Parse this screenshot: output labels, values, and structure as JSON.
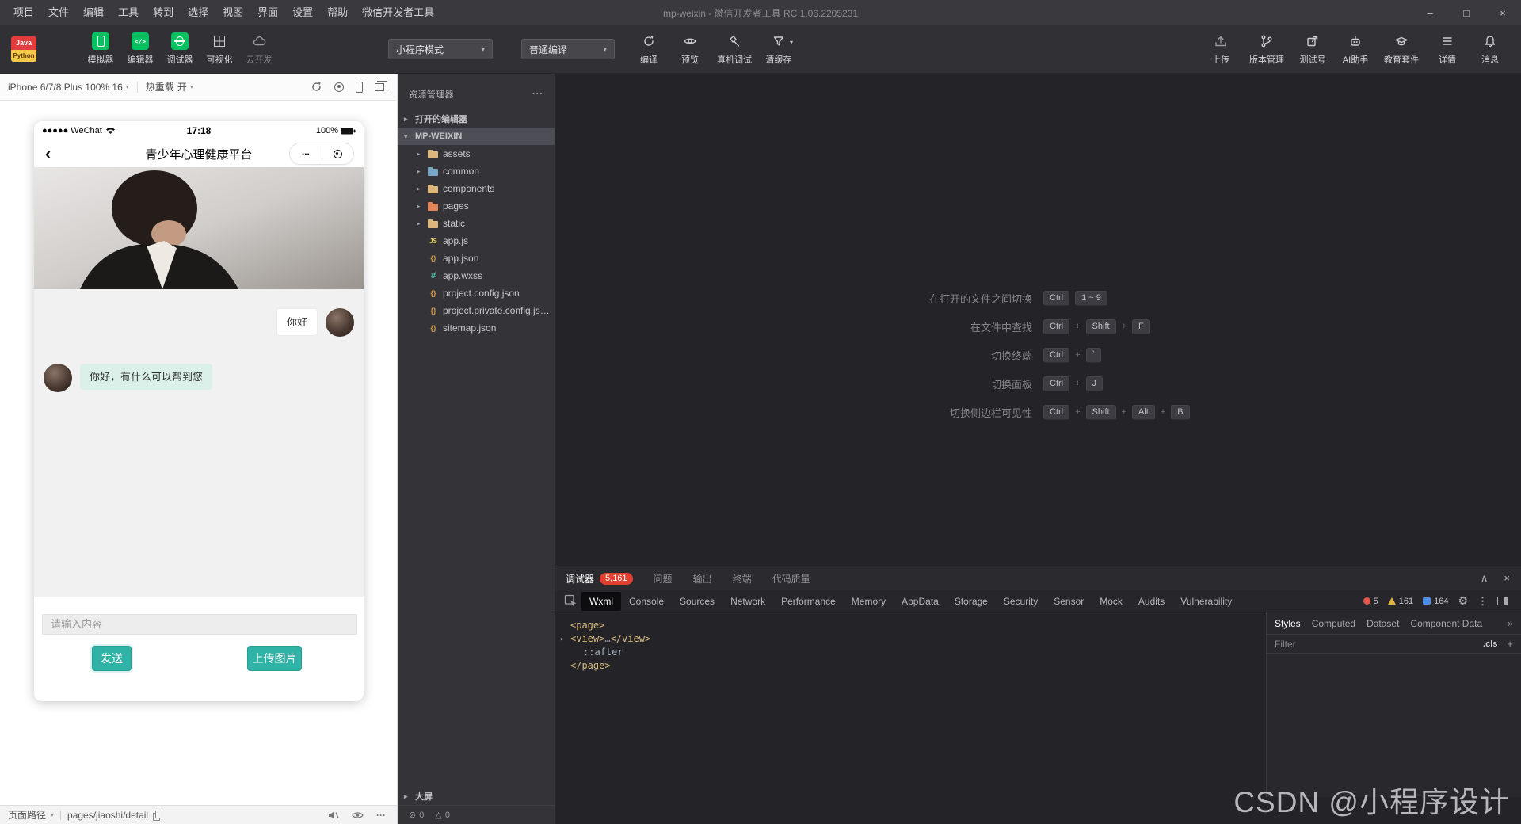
{
  "icons": {
    "minimize": "–",
    "maximize": "□",
    "close": "×",
    "collapse": "∧",
    "caret_down": "▾",
    "caret_right": "▸",
    "back": "‹",
    "more_h": "···",
    "more_v": "⋮",
    "overflow": "»",
    "add": "+",
    "gear": "⚙",
    "capsule_dots": "···",
    "error": "⊘",
    "warning": "△"
  },
  "menubar": {
    "items": [
      "项目",
      "文件",
      "编辑",
      "工具",
      "转到",
      "选择",
      "视图",
      "界面",
      "设置",
      "帮助",
      "微信开发者工具"
    ],
    "title": "mp-weixin - 微信开发者工具 RC 1.06.2205231"
  },
  "toolbar": {
    "logo_top": "Java",
    "logo_bottom": "Python",
    "simulator_label": "模拟器",
    "editor_label": "编辑器",
    "debugger_label": "调试器",
    "visual_label": "可视化",
    "cloud_label": "云开发",
    "mode_select": "小程序模式",
    "compile_select": "普通编译",
    "compile_label": "编译",
    "preview_label": "预览",
    "device_debug_label": "真机调试",
    "clear_cache_label": "清缓存",
    "upload_label": "上传",
    "version_label": "版本管理",
    "test_account_label": "测试号",
    "ai_label": "AI助手",
    "edu_label": "教育套件",
    "details_label": "详情",
    "messages_label": "消息"
  },
  "simulator": {
    "device_label": "iPhone 6/7/8 Plus 100% 16",
    "hot_reload_label": "热重载",
    "hot_reload_value": "开",
    "phone": {
      "carrier": "●●●●● WeChat",
      "time": "17:18",
      "battery": "100%",
      "nav_title": "青少年心理健康平台",
      "messages": [
        {
          "side": "right",
          "text": "你好"
        },
        {
          "side": "left",
          "text": "你好，有什么可以帮到您"
        }
      ],
      "input_placeholder": "请输入内容",
      "send_button": "发送",
      "upload_button": "上传图片"
    },
    "statusbar": {
      "page_path_label": "页面路径",
      "page_path": "pages/jiaoshi/detail"
    }
  },
  "explorer": {
    "title": "资源管理器",
    "open_editors": "打开的编辑器",
    "project": "MP-WEIXIN",
    "tree": [
      {
        "name": "assets",
        "kind": "folder",
        "color": "#dcb67a"
      },
      {
        "name": "common",
        "kind": "folder",
        "color": "#7ba7c7"
      },
      {
        "name": "components",
        "kind": "folder",
        "color": "#dcb67a"
      },
      {
        "name": "pages",
        "kind": "folder",
        "color": "#e0845a"
      },
      {
        "name": "static",
        "kind": "folder",
        "color": "#dcb67a"
      },
      {
        "name": "app.js",
        "kind": "js"
      },
      {
        "name": "app.json",
        "kind": "json"
      },
      {
        "name": "app.wxss",
        "kind": "wxss"
      },
      {
        "name": "project.config.json",
        "kind": "json"
      },
      {
        "name": "project.private.config.js…",
        "kind": "json"
      },
      {
        "name": "sitemap.json",
        "kind": "json"
      }
    ],
    "bottom_section": "大屏",
    "error_count": "0",
    "warning_count": "0"
  },
  "editor": {
    "shortcuts": [
      {
        "label": "在打开的文件之间切换",
        "keys": [
          "Ctrl",
          "1 ~ 9"
        ],
        "plus": false
      },
      {
        "label": "在文件中查找",
        "keys": [
          "Ctrl",
          "Shift",
          "F"
        ],
        "plus": true
      },
      {
        "label": "切换终端",
        "keys": [
          "Ctrl",
          "`"
        ],
        "plus": true
      },
      {
        "label": "切换面板",
        "keys": [
          "Ctrl",
          "J"
        ],
        "plus": true
      },
      {
        "label": "切换侧边栏可见性",
        "keys": [
          "Ctrl",
          "Shift",
          "Alt",
          "B"
        ],
        "plus": true
      }
    ]
  },
  "debugger": {
    "tabs": [
      {
        "label": "调试器",
        "badge": "5,161",
        "state": "active"
      },
      {
        "label": "问题",
        "state": ""
      },
      {
        "label": "输出",
        "state": ""
      },
      {
        "label": "终端",
        "state": ""
      },
      {
        "label": "代码质量",
        "state": ""
      }
    ],
    "devtools_tabs": [
      {
        "label": "Wxml",
        "state": "active"
      },
      {
        "label": "Console",
        "state": ""
      },
      {
        "label": "Sources",
        "state": ""
      },
      {
        "label": "Network",
        "state": ""
      },
      {
        "label": "Performance",
        "state": ""
      },
      {
        "label": "Memory",
        "state": ""
      },
      {
        "label": "AppData",
        "state": ""
      },
      {
        "label": "Storage",
        "state": ""
      },
      {
        "label": "Security",
        "state": ""
      },
      {
        "label": "Sensor",
        "state": ""
      },
      {
        "label": "Mock",
        "state": ""
      },
      {
        "label": "Audits",
        "state": ""
      },
      {
        "label": "Vulnerability",
        "state": ""
      }
    ],
    "counters": {
      "errors": "5",
      "warnings": "161",
      "infos": "164"
    },
    "wxml_code": [
      {
        "arrow": false,
        "indent": 0,
        "parts": [
          {
            "t": "tag",
            "v": "<page>"
          }
        ]
      },
      {
        "arrow": true,
        "indent": 0,
        "parts": [
          {
            "t": "tag",
            "v": "<view>"
          },
          {
            "t": "dim",
            "v": "…"
          },
          {
            "t": "tag",
            "v": "</view>"
          }
        ]
      },
      {
        "arrow": false,
        "indent": 1,
        "parts": [
          {
            "t": "pseudo",
            "v": "::after"
          }
        ]
      },
      {
        "arrow": false,
        "indent": 0,
        "parts": [
          {
            "t": "tag",
            "v": "</page>"
          }
        ]
      }
    ],
    "styles_panel": {
      "tabs": [
        {
          "label": "Styles",
          "state": "active"
        },
        {
          "label": "Computed",
          "state": ""
        },
        {
          "label": "Dataset",
          "state": ""
        },
        {
          "label": "Component Data",
          "state": ""
        }
      ],
      "filter_placeholder": "Filter",
      "cls_label": ".cls"
    }
  },
  "watermark": "CSDN @小程序设计"
}
